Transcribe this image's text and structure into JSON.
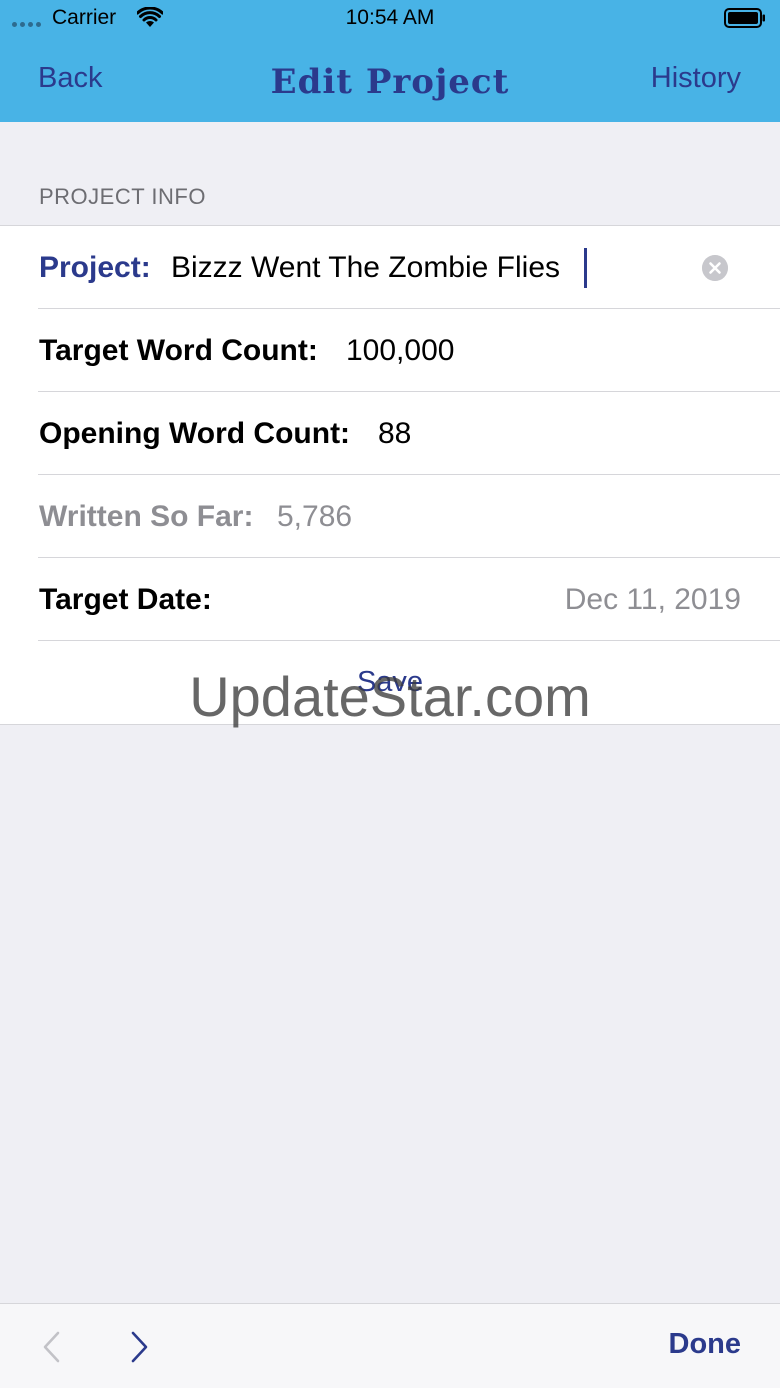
{
  "status_bar": {
    "carrier": "Carrier",
    "time": "10:54 AM"
  },
  "nav": {
    "back_label": "Back",
    "title": "Edit Project",
    "history_label": "History"
  },
  "section": {
    "header": "PROJECT INFO"
  },
  "form": {
    "project": {
      "label": "Project:",
      "value": "Bizzz Went The Zombie Flies"
    },
    "target_word_count": {
      "label": "Target Word Count:",
      "value": "100,000"
    },
    "opening_word_count": {
      "label": "Opening Word Count:",
      "value": "88"
    },
    "written_so_far": {
      "label": "Written So Far:",
      "value": "5,786"
    },
    "target_date": {
      "label": "Target Date:",
      "value": "Dec 11, 2019"
    },
    "save_label": "Save"
  },
  "watermark": "UpdateStar.com",
  "toolbar": {
    "done_label": "Done"
  },
  "colors": {
    "header_bg": "#48b3e6",
    "accent": "#2b3a8c",
    "secondary_text": "#8e8e93",
    "page_bg": "#efeff4"
  },
  "icons": {
    "wifi": "wifi-icon",
    "battery": "battery-icon",
    "clear": "clear-circle-icon",
    "prev": "chevron-left-icon",
    "next": "chevron-right-icon"
  }
}
